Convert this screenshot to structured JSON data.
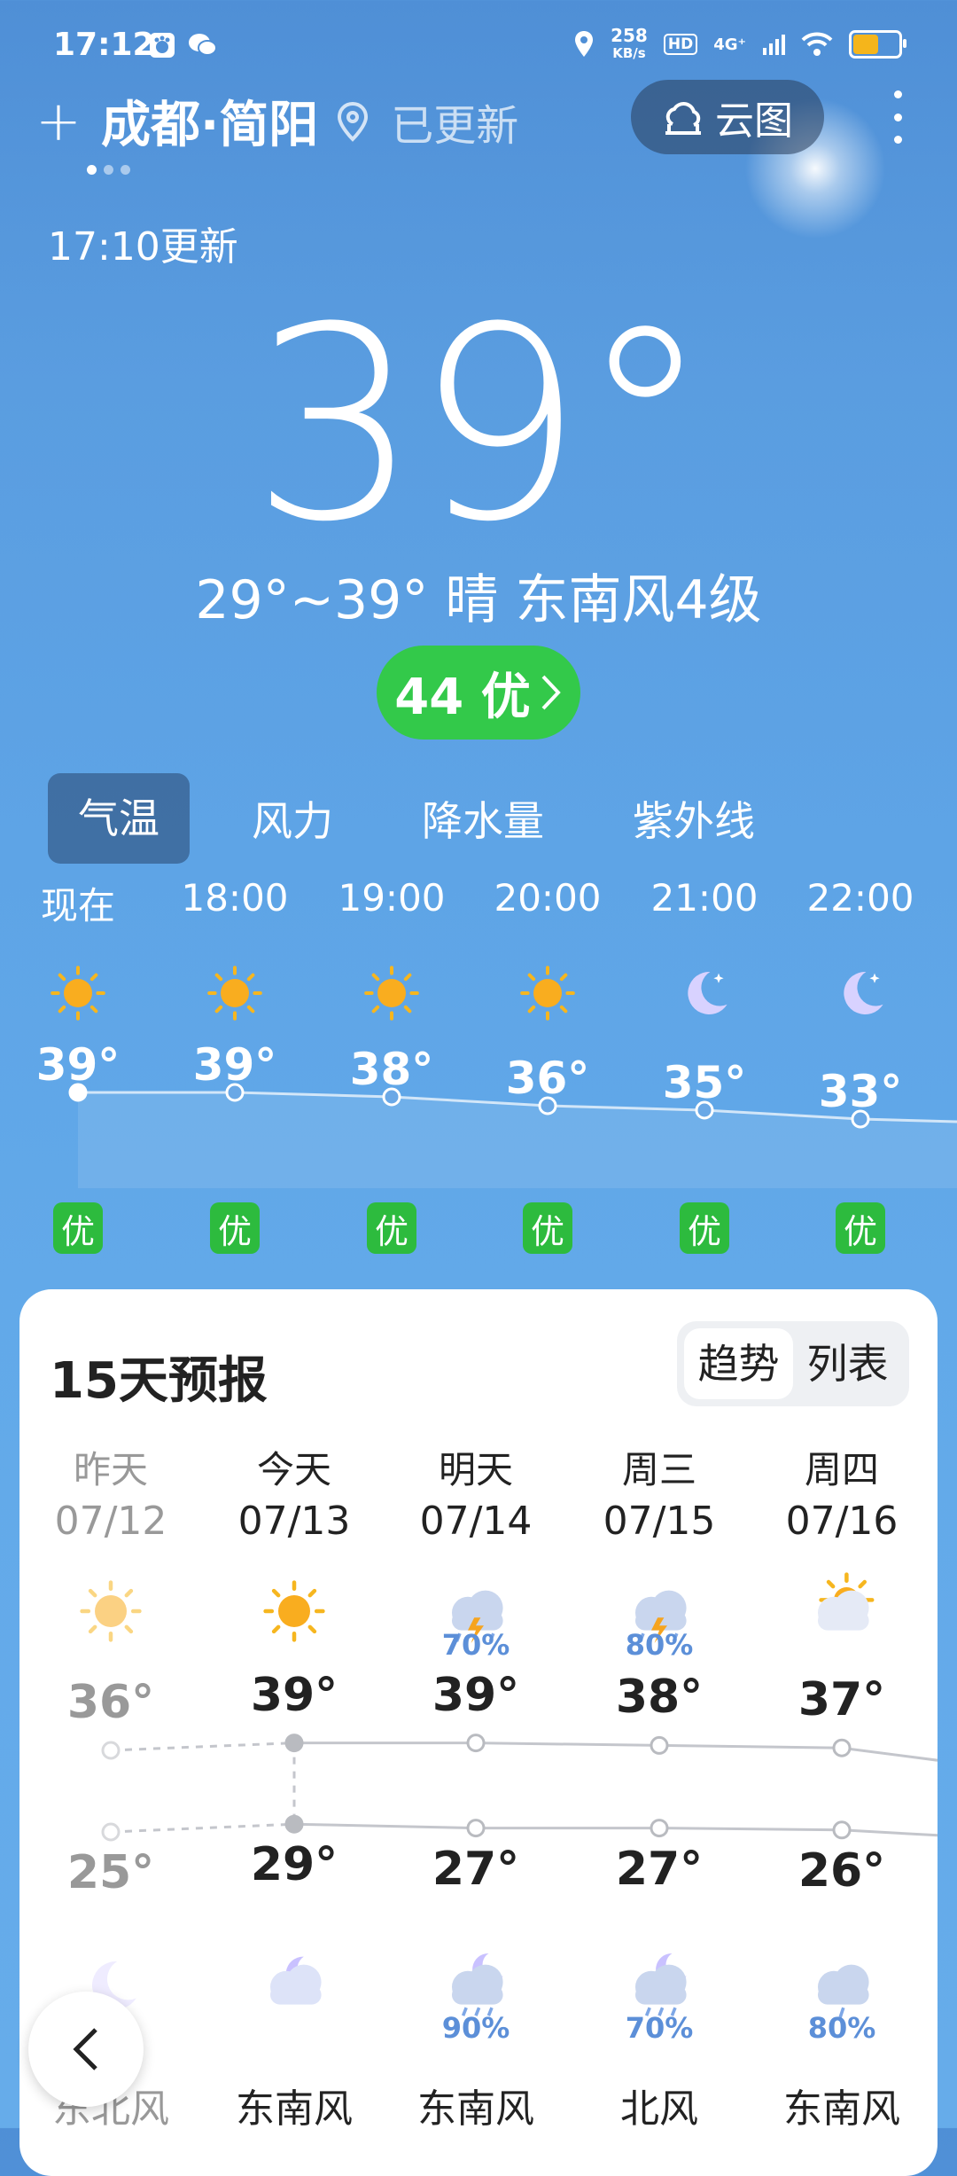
{
  "status_bar": {
    "time": "17:12",
    "net_speed_value": "258",
    "net_speed_unit": "KB/s",
    "hd": "HD",
    "network": "4G⁺"
  },
  "header": {
    "city": "成都·简阳",
    "updated_label": "已更新",
    "cloud_button": "云图",
    "update_time": "17:10更新"
  },
  "current": {
    "temp": "39°",
    "summary": "29°~39° 晴 东南风4级",
    "aqi": "44 优"
  },
  "tabs": [
    "气温",
    "风力",
    "降水量",
    "紫外线"
  ],
  "hourly": [
    {
      "time": "现在",
      "icon": "sun-icon",
      "temp": "39°",
      "temp_value": 39,
      "aq": "优"
    },
    {
      "time": "18:00",
      "icon": "sun-icon",
      "temp": "39°",
      "temp_value": 39,
      "aq": "优"
    },
    {
      "time": "19:00",
      "icon": "sun-icon",
      "temp": "38°",
      "temp_value": 38,
      "aq": "优"
    },
    {
      "time": "20:00",
      "icon": "sun-icon",
      "temp": "36°",
      "temp_value": 36,
      "aq": "优"
    },
    {
      "time": "21:00",
      "icon": "moon-icon",
      "temp": "35°",
      "temp_value": 35,
      "aq": "优"
    },
    {
      "time": "22:00",
      "icon": "moon-icon",
      "temp": "33°",
      "temp_value": 33,
      "aq": "优"
    }
  ],
  "forecast": {
    "title": "15天预报",
    "view_trend": "趋势",
    "view_list": "列表",
    "days": [
      {
        "name": "昨天",
        "date": "07/12",
        "day_icon": "sun-icon",
        "day_pop": "",
        "high": "36°",
        "high_value": 36,
        "low": "25°",
        "low_value": 25,
        "night_icon": "moon-icon",
        "night_pop": "",
        "wind": "东北风",
        "past": true
      },
      {
        "name": "今天",
        "date": "07/13",
        "day_icon": "sun-icon",
        "day_pop": "",
        "high": "39°",
        "high_value": 39,
        "low": "29°",
        "low_value": 29,
        "night_icon": "cloud-moon-icon",
        "night_pop": "",
        "wind": "东南风",
        "past": false
      },
      {
        "name": "明天",
        "date": "07/14",
        "day_icon": "thunderstorm-icon",
        "day_pop": "70%",
        "high": "39°",
        "high_value": 39,
        "low": "27°",
        "low_value": 27,
        "night_icon": "rain-moon-icon",
        "night_pop": "90%",
        "wind": "东南风",
        "past": false
      },
      {
        "name": "周三",
        "date": "07/15",
        "day_icon": "thunderstorm-icon",
        "day_pop": "80%",
        "high": "38°",
        "high_value": 38,
        "low": "27°",
        "low_value": 27,
        "night_icon": "rain-moon-icon",
        "night_pop": "70%",
        "wind": "北风",
        "past": false
      },
      {
        "name": "周四",
        "date": "07/16",
        "day_icon": "partly-cloudy-icon",
        "day_pop": "",
        "high": "37°",
        "high_value": 37,
        "low": "26°",
        "low_value": 26,
        "night_icon": "rain-cloud-icon",
        "night_pop": "80%",
        "wind": "东南风",
        "past": false
      }
    ]
  },
  "colors": {
    "aqi_good": "#33c94a",
    "accent_blue": "#5c8fd8"
  }
}
